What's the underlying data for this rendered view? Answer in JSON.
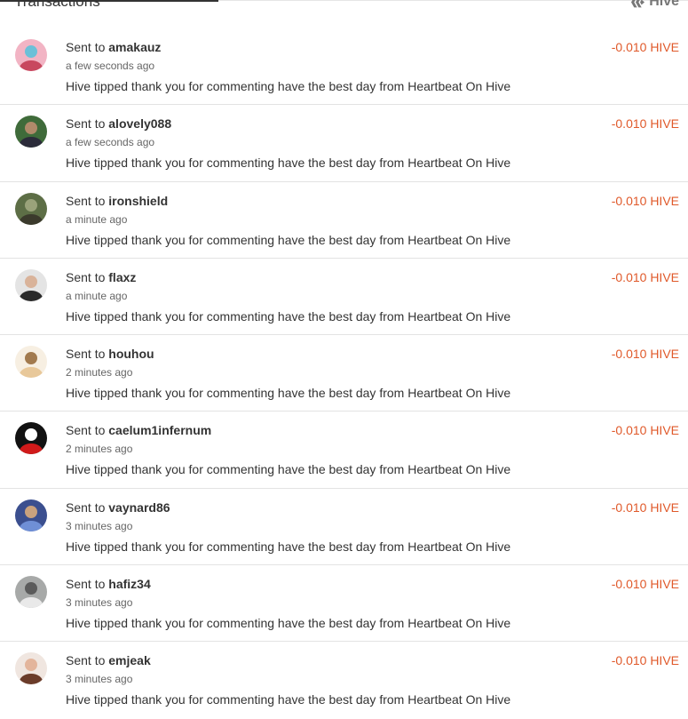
{
  "header": {
    "title": "Transactions",
    "brand": "Hive"
  },
  "colors": {
    "amount": "#e0592a",
    "text": "#333333",
    "muted": "#666666",
    "divider": "#e3e3e3"
  },
  "transactions": [
    {
      "sent_label": "Sent to",
      "user": "amakauz",
      "time": "a few seconds ago",
      "memo": "Hive tipped thank you for commenting have the best day from Heartbeat On Hive",
      "amount": "-0.010 HIVE",
      "avatar": {
        "bg": "#f2b4c4",
        "fg": "#c8485f",
        "accent": "#6cc0d8"
      }
    },
    {
      "sent_label": "Sent to",
      "user": "alovely088",
      "time": "a few seconds ago",
      "memo": "Hive tipped thank you for commenting have the best day from Heartbeat On Hive",
      "amount": "-0.010 HIVE",
      "avatar": {
        "bg": "#3f6b3a",
        "fg": "#2b2b3a",
        "accent": "#b08a6a"
      }
    },
    {
      "sent_label": "Sent to",
      "user": "ironshield",
      "time": "a minute ago",
      "memo": "Hive tipped thank you for commenting have the best day from Heartbeat On Hive",
      "amount": "-0.010 HIVE",
      "avatar": {
        "bg": "#5d6e46",
        "fg": "#3b3a2c",
        "accent": "#9aa27a"
      }
    },
    {
      "sent_label": "Sent to",
      "user": "flaxz",
      "time": "a minute ago",
      "memo": "Hive tipped thank you for commenting have the best day from Heartbeat On Hive",
      "amount": "-0.010 HIVE",
      "avatar": {
        "bg": "#e4e4e4",
        "fg": "#2a2a2a",
        "accent": "#d9b39a"
      }
    },
    {
      "sent_label": "Sent to",
      "user": "houhou",
      "time": "2 minutes ago",
      "memo": "Hive tipped thank you for commenting have the best day from Heartbeat On Hive",
      "amount": "-0.010 HIVE",
      "avatar": {
        "bg": "#f7efe2",
        "fg": "#e8c89a",
        "accent": "#a27a4e"
      }
    },
    {
      "sent_label": "Sent to",
      "user": "caelum1infernum",
      "time": "2 minutes ago",
      "memo": "Hive tipped thank you for commenting have the best day from Heartbeat On Hive",
      "amount": "-0.010 HIVE",
      "avatar": {
        "bg": "#121212",
        "fg": "#d11a1a",
        "accent": "#ffffff"
      }
    },
    {
      "sent_label": "Sent to",
      "user": "vaynard86",
      "time": "3 minutes ago",
      "memo": "Hive tipped thank you for commenting have the best day from Heartbeat On Hive",
      "amount": "-0.010 HIVE",
      "avatar": {
        "bg": "#3b4f8f",
        "fg": "#6f8fd6",
        "accent": "#c9a27e"
      }
    },
    {
      "sent_label": "Sent to",
      "user": "hafiz34",
      "time": "3 minutes ago",
      "memo": "Hive tipped thank you for commenting have the best day from Heartbeat On Hive",
      "amount": "-0.010 HIVE",
      "avatar": {
        "bg": "#a7a9a8",
        "fg": "#e9e9e9",
        "accent": "#5b5b5b"
      }
    },
    {
      "sent_label": "Sent to",
      "user": "emjeak",
      "time": "3 minutes ago",
      "memo": "Hive tipped thank you for commenting have the best day from Heartbeat On Hive",
      "amount": "-0.010 HIVE",
      "avatar": {
        "bg": "#f0e6e0",
        "fg": "#6b3c2a",
        "accent": "#e3b59c"
      }
    }
  ]
}
